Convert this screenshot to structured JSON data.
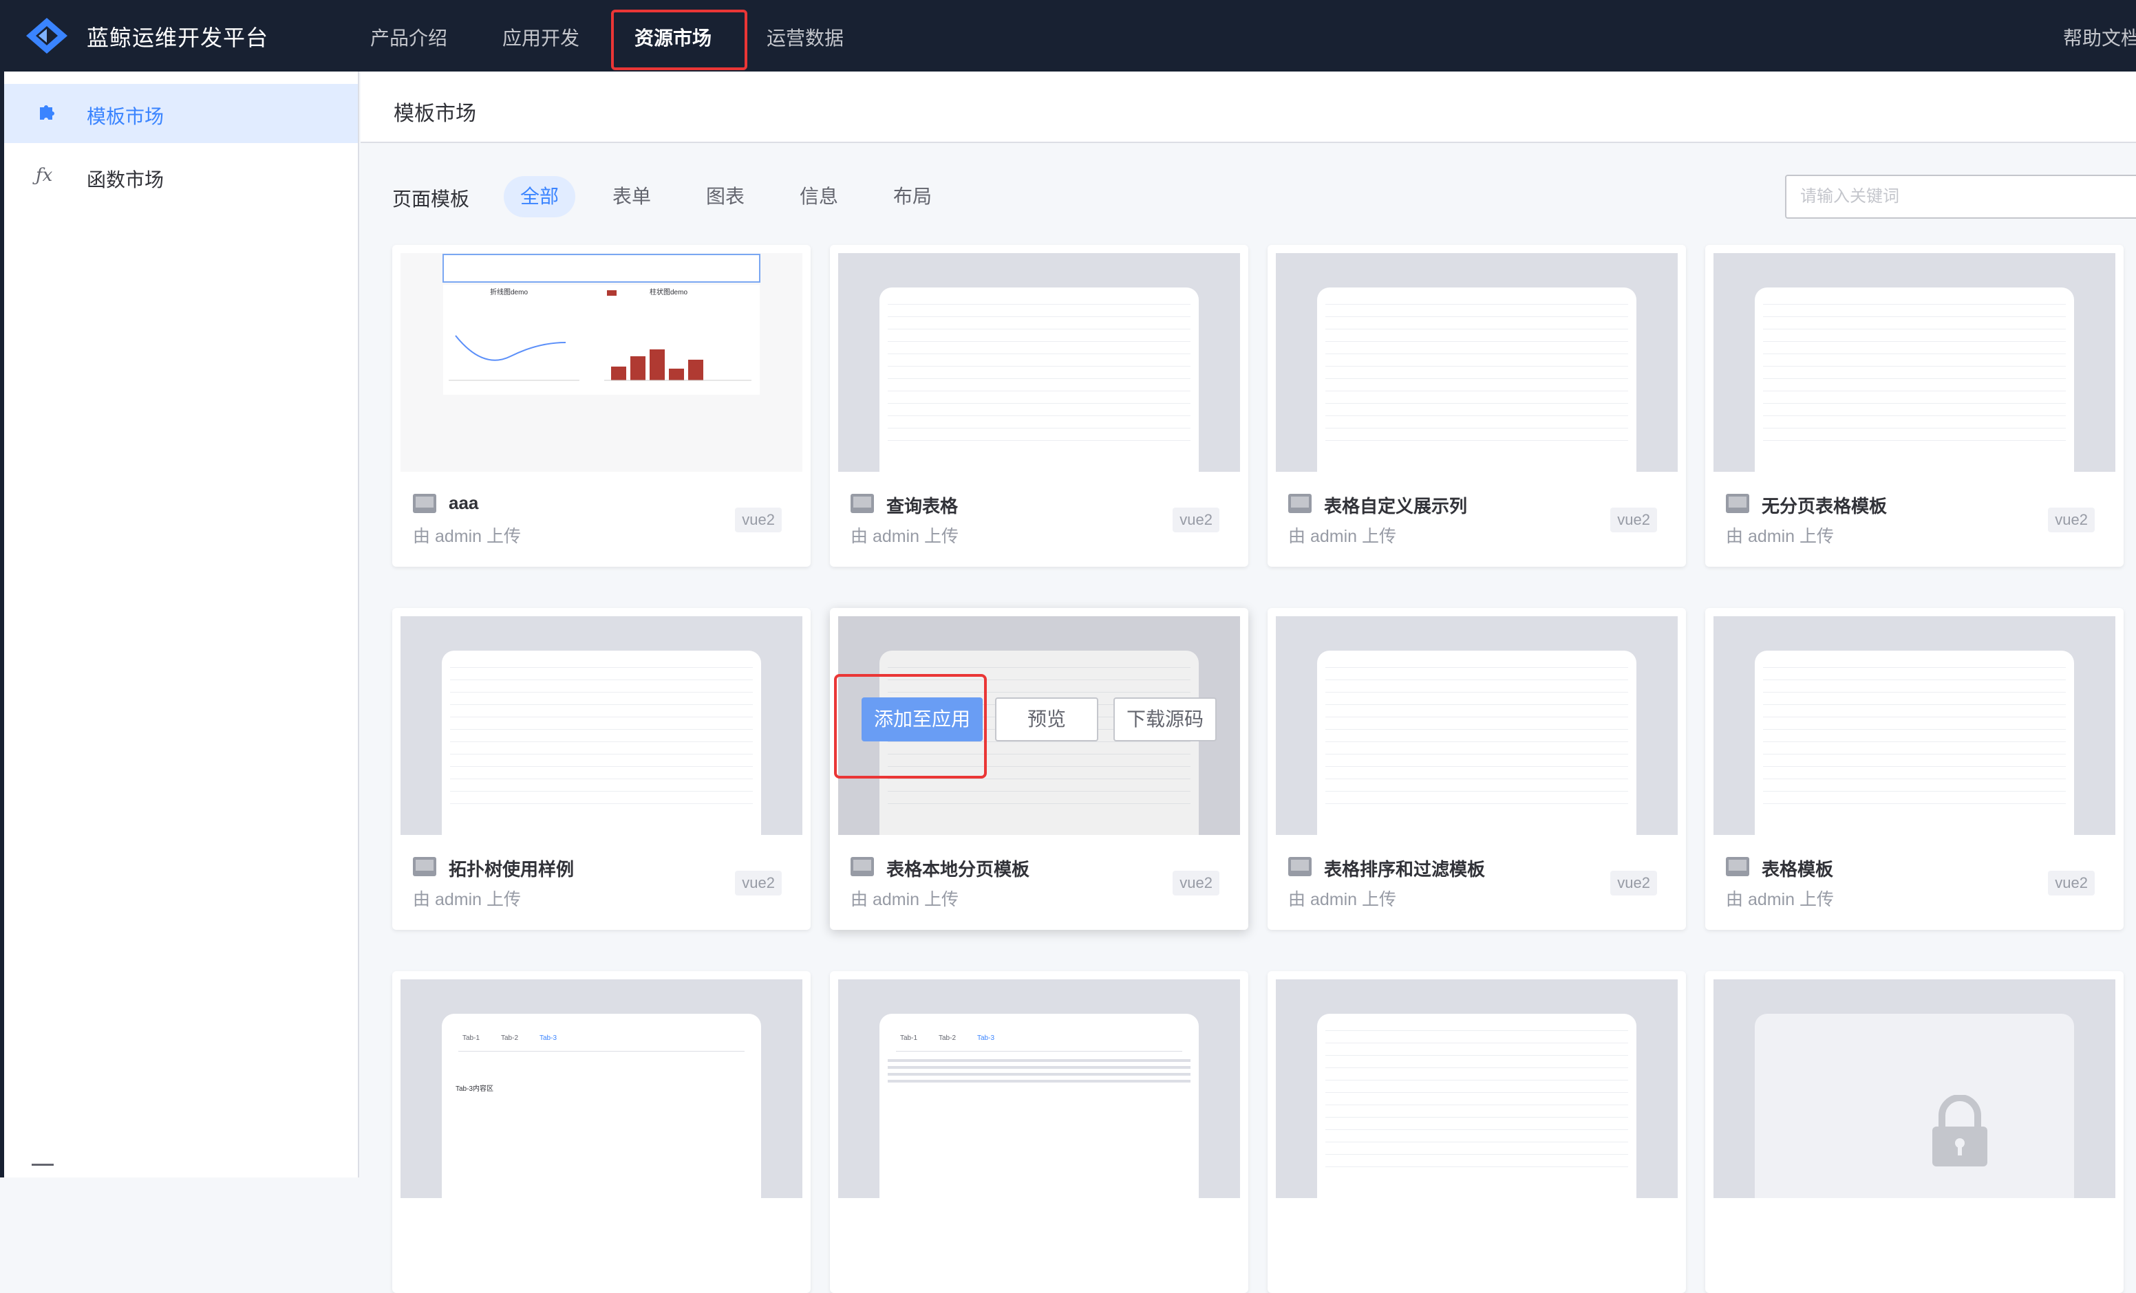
{
  "header": {
    "brand": "蓝鲸运维开发平台",
    "nav": [
      {
        "label": "产品介绍"
      },
      {
        "label": "应用开发"
      },
      {
        "label": "资源市场",
        "active": true
      },
      {
        "label": "运营数据"
      }
    ],
    "help": "帮助文档"
  },
  "sidebar": {
    "items": [
      {
        "label": "模板市场",
        "icon": "puzzle-icon",
        "active": true
      },
      {
        "label": "函数市场",
        "icon": "function-icon",
        "glyph": "ƒx"
      }
    ]
  },
  "main": {
    "title": "模板市场",
    "filter": {
      "label": "页面模板",
      "tabs": [
        {
          "label": "全部",
          "active": true
        },
        {
          "label": "表单"
        },
        {
          "label": "图表"
        },
        {
          "label": "信息"
        },
        {
          "label": "布局"
        }
      ],
      "search_placeholder": "请输入关键词"
    },
    "cards": [
      {
        "title": "aaa",
        "meta": "由 admin 上传",
        "tag": "vue2",
        "preview": "chart"
      },
      {
        "title": "查询表格",
        "meta": "由 admin 上传",
        "tag": "vue2",
        "preview": "table"
      },
      {
        "title": "表格自定义展示列",
        "meta": "由 admin 上传",
        "tag": "vue2",
        "preview": "table"
      },
      {
        "title": "无分页表格模板",
        "meta": "由 admin 上传",
        "tag": "vue2",
        "preview": "table"
      },
      {
        "title": "拓扑树使用样例",
        "meta": "由 admin 上传",
        "tag": "vue2",
        "preview": "tree"
      },
      {
        "title": "表格本地分页模板",
        "meta": "由 admin 上传",
        "tag": "vue2",
        "preview": "table",
        "hovered": true
      },
      {
        "title": "表格排序和过滤模板",
        "meta": "由 admin 上传",
        "tag": "vue2",
        "preview": "table"
      },
      {
        "title": "表格模板",
        "meta": "由 admin 上传",
        "tag": "vue2",
        "preview": "table"
      },
      {
        "title": "",
        "meta": "",
        "tag": "",
        "preview": "tabs"
      },
      {
        "title": "",
        "meta": "",
        "tag": "",
        "preview": "tabs-text"
      },
      {
        "title": "",
        "meta": "",
        "tag": "",
        "preview": "table"
      },
      {
        "title": "",
        "meta": "",
        "tag": "",
        "preview": "locked"
      }
    ],
    "hover_actions": {
      "add": "添加至应用",
      "preview": "预览",
      "download": "下载源码"
    },
    "thumb_text": {
      "chart_left_title": "折线图demo",
      "chart_right_title": "柱状图demo",
      "tab1": "Tab-1",
      "tab2": "Tab-2",
      "tab3": "Tab-3",
      "tab3_content": "Tab-3内容区"
    }
  },
  "colors": {
    "topbar": "#182132",
    "accent": "#3a84ff",
    "highlight": "#ea3636",
    "bar": "#b03a32"
  }
}
